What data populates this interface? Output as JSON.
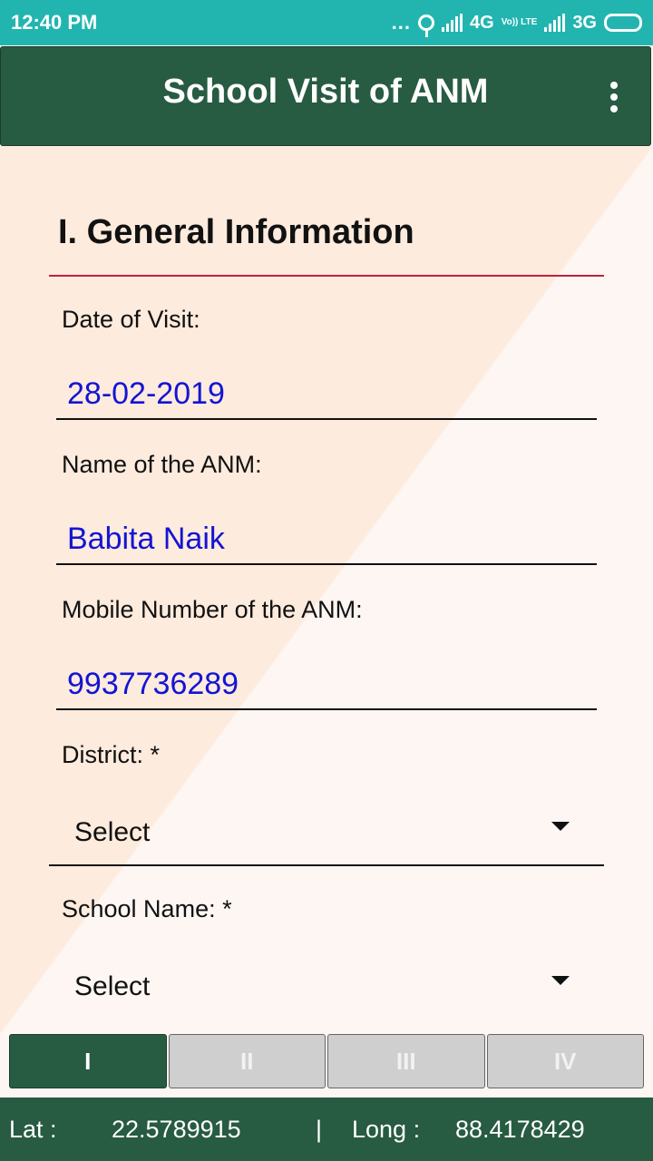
{
  "status_bar": {
    "time": "12:40 PM",
    "dots": "...",
    "network1": "4G",
    "volte": "Vo)) LTE",
    "network2": "3G"
  },
  "app_bar": {
    "title": "School Visit of ANM",
    "menu_icon": "more-vert-icon"
  },
  "section": {
    "title": "I. General Information"
  },
  "fields": {
    "date_label": "Date of Visit:",
    "date_value": "28-02-2019",
    "name_label": "Name of the ANM:",
    "name_value": "Babita Naik",
    "mobile_label": "Mobile Number of the ANM:",
    "mobile_value": "9937736289",
    "district_label": "District: *",
    "district_value": "Select",
    "school_label": "School Name: *",
    "school_value": "Select"
  },
  "tabs": [
    {
      "label": "I",
      "active": true
    },
    {
      "label": "II",
      "active": false
    },
    {
      "label": "III",
      "active": false
    },
    {
      "label": "IV",
      "active": false
    }
  ],
  "footer": {
    "lat_label": "Lat :",
    "lat_value": "22.5789915",
    "separator": "|",
    "long_label": "Long :",
    "long_value": "88.4178429"
  },
  "colors": {
    "status_bar": "#22b5b0",
    "primary": "#275b42",
    "value_text": "#1414d4",
    "section_rule": "#c2203f",
    "tab_inactive": "#cfcfcf"
  }
}
